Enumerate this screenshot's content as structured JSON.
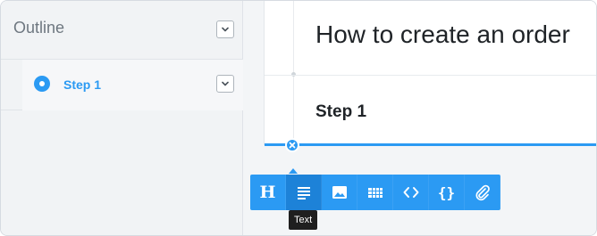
{
  "sidebar": {
    "title": "Outline",
    "items": [
      {
        "label": "Step 1",
        "active": true
      }
    ]
  },
  "document": {
    "title": "How to create an order",
    "steps": [
      {
        "heading": "Step 1"
      }
    ]
  },
  "insert_toolbar": {
    "tools": [
      {
        "name": "Heading",
        "icon": "heading-icon"
      },
      {
        "name": "Text",
        "icon": "text-icon",
        "active": true
      },
      {
        "name": "Image",
        "icon": "image-icon"
      },
      {
        "name": "Table",
        "icon": "table-icon"
      },
      {
        "name": "Code",
        "icon": "code-icon"
      },
      {
        "name": "Code block",
        "icon": "braces-icon"
      },
      {
        "name": "Attachment",
        "icon": "paperclip-icon"
      }
    ],
    "tooltip": "Text"
  },
  "colors": {
    "accent": "#2b9af3",
    "accent_active": "#1d82d8",
    "sidebar_bg": "#f1f3f5",
    "tooltip_bg": "#1f1f1f"
  }
}
